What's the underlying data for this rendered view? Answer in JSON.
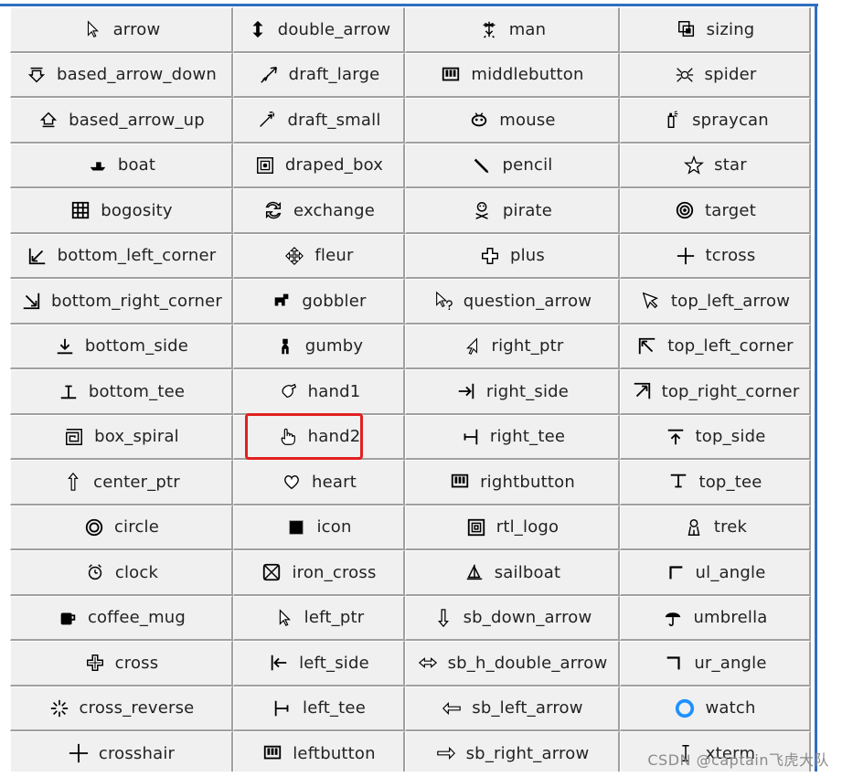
{
  "cells": [
    [
      "arrow",
      "double_arrow",
      "man",
      "sizing"
    ],
    [
      "based_arrow_down",
      "draft_large",
      "middlebutton",
      "spider"
    ],
    [
      "based_arrow_up",
      "draft_small",
      "mouse",
      "spraycan"
    ],
    [
      "boat",
      "draped_box",
      "pencil",
      "star"
    ],
    [
      "bogosity",
      "exchange",
      "pirate",
      "target"
    ],
    [
      "bottom_left_corner",
      "fleur",
      "plus",
      "tcross"
    ],
    [
      "bottom_right_corner",
      "gobbler",
      "question_arrow",
      "top_left_arrow"
    ],
    [
      "bottom_side",
      "gumby",
      "right_ptr",
      "top_left_corner"
    ],
    [
      "bottom_tee",
      "hand1",
      "right_side",
      "top_right_corner"
    ],
    [
      "box_spiral",
      "hand2",
      "right_tee",
      "top_side"
    ],
    [
      "center_ptr",
      "heart",
      "rightbutton",
      "top_tee"
    ],
    [
      "circle",
      "icon",
      "rtl_logo",
      "trek"
    ],
    [
      "clock",
      "iron_cross",
      "sailboat",
      "ul_angle"
    ],
    [
      "coffee_mug",
      "left_ptr",
      "sb_down_arrow",
      "umbrella"
    ],
    [
      "cross",
      "left_side",
      "sb_h_double_arrow",
      "ur_angle"
    ],
    [
      "cross_reverse",
      "left_tee",
      "sb_left_arrow",
      "watch"
    ],
    [
      "crosshair",
      "leftbutton",
      "sb_right_arrow",
      "xterm"
    ]
  ],
  "highlighted": "hand2",
  "highlight_color": "#e02020",
  "watch_color": "#1e90ff",
  "watermark": "CSDN @captain飞虎大队"
}
